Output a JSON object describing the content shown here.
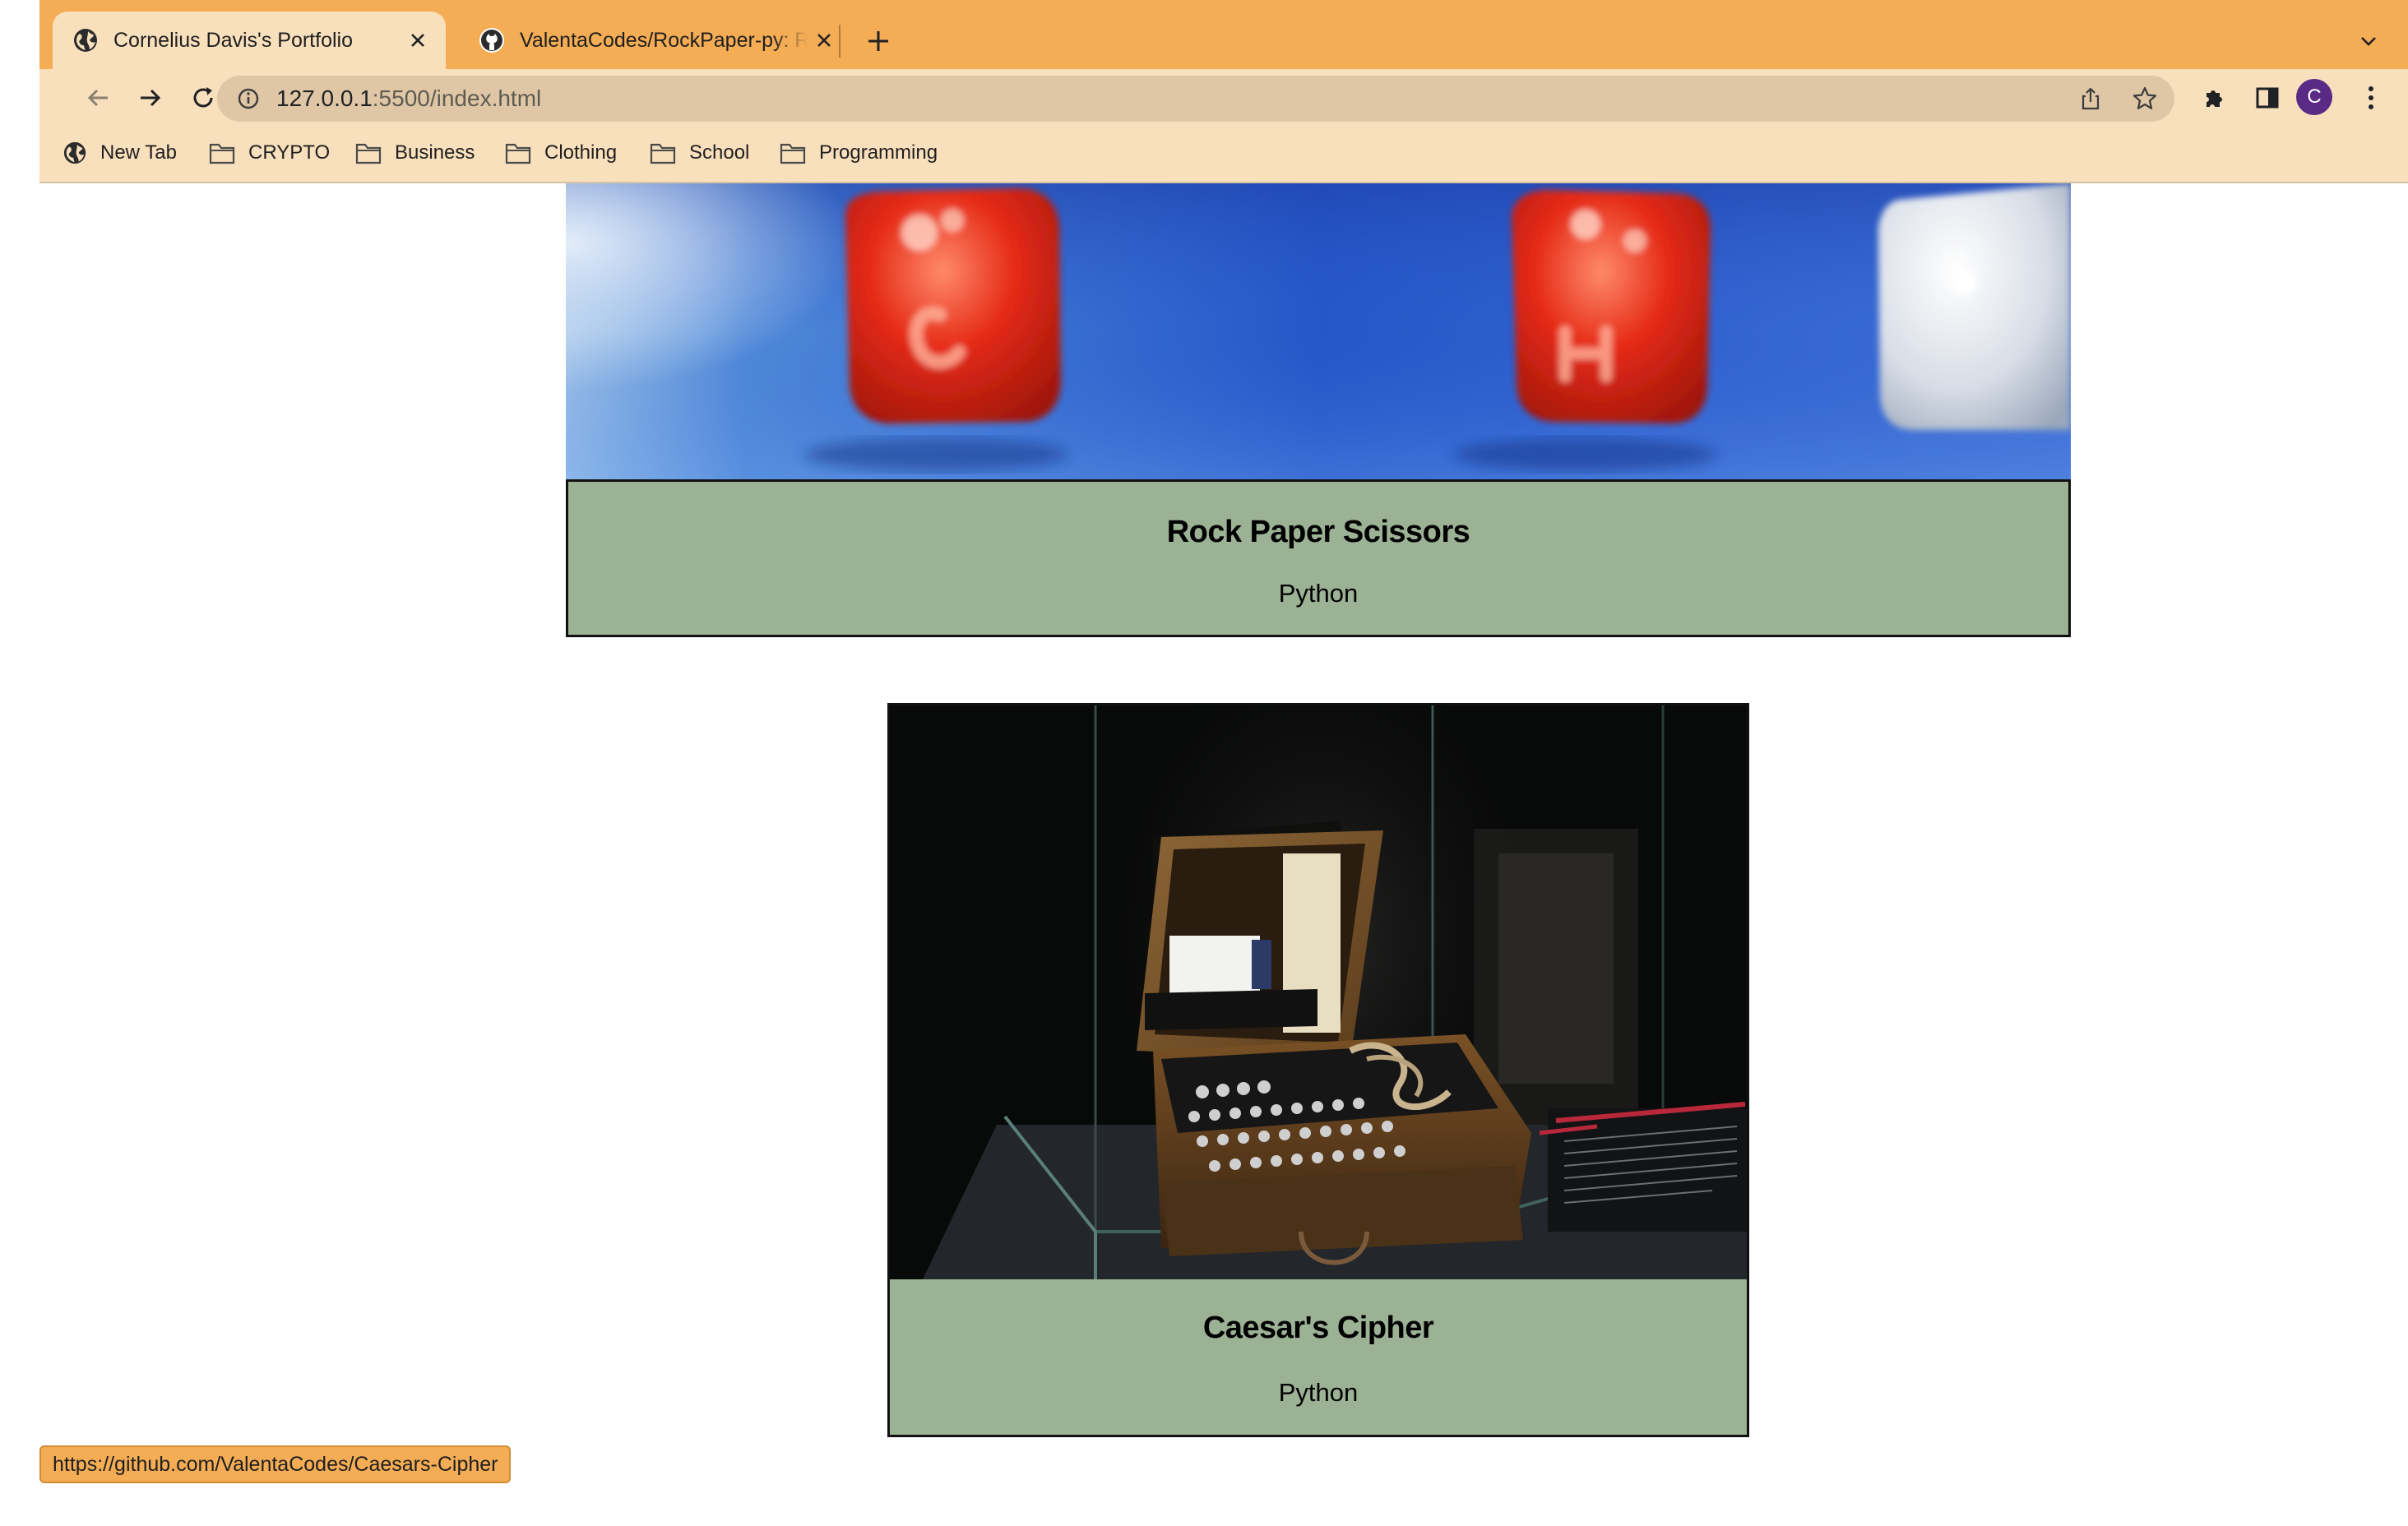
{
  "browser": {
    "tabs": [
      {
        "title": "Cornelius Davis's Portfolio",
        "active": true
      },
      {
        "title": "ValentaCodes/RockPaper-py: R",
        "active": false
      }
    ],
    "url_host": "127.0.0.1",
    "url_path": ":5500/index.html",
    "profile_initial": "C",
    "bookmarks": [
      "New Tab",
      "CRYPTO",
      "Business",
      "Clothing",
      "School",
      "Programming"
    ]
  },
  "projects": [
    {
      "title": "Rock Paper Scissors",
      "language": "Python"
    },
    {
      "title": "Caesar's Cipher",
      "language": "Python"
    }
  ],
  "status_bar": {
    "link": "https://github.com/ValentaCodes/Caesars-Cipher"
  },
  "colors": {
    "tab_strip": "#f4ad55",
    "toolbar": "#f9e0bc",
    "omnibox": "#dfc7a6",
    "card_caption": "#9bb294",
    "avatar": "#5b2a86"
  }
}
